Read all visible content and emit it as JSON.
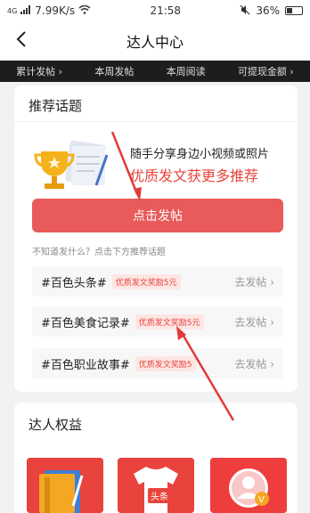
{
  "status_bar": {
    "signal": "4G",
    "speed": "7.99K/s",
    "time": "21:58",
    "battery": "36%"
  },
  "nav": {
    "title": "达人中心"
  },
  "stats": [
    "累计发帖 ›",
    "本周发帖",
    "本周阅读",
    "可提现金额 ›"
  ],
  "recommend": {
    "title": "推荐话题",
    "promo_line1": "随手分享身边小视频或照片",
    "promo_line2": "优质发文获更多推荐",
    "post_button": "点击发帖",
    "hint": "不知道发什么？点击下方推荐话题",
    "topics": [
      {
        "name": "#百色头条#",
        "badge": "优质发文奖励5元",
        "action": "去发帖 ›"
      },
      {
        "name": "#百色美食记录#",
        "badge": "优质发文奖励5元",
        "action": "去发帖 ›"
      },
      {
        "name": "#百色职业故事#",
        "badge": "优质发文奖励5",
        "action": "去发帖 ›"
      }
    ]
  },
  "benefits": {
    "title": "达人权益",
    "tshirt_label": "头条"
  },
  "colors": {
    "accent": "#e8433c",
    "button": "#e95a5a",
    "dark_bar": "#1d1d1d"
  }
}
